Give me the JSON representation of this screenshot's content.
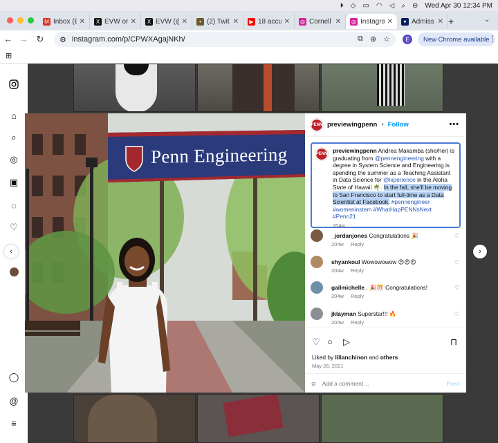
{
  "menubar": {
    "datetime": "Wed Apr 30  12:34 PM"
  },
  "tabs": [
    {
      "label": "Inbox (E",
      "icon": "gmail-icon",
      "color": "#d93025",
      "glyph": "M"
    },
    {
      "label": "EVW on",
      "icon": "x-icon",
      "color": "#111111",
      "glyph": "X"
    },
    {
      "label": "EVW (@",
      "icon": "x-icon",
      "color": "#111111",
      "glyph": "X"
    },
    {
      "label": "(2) Twit",
      "icon": "twitter-icon",
      "color": "#6b5a2a",
      "glyph": "•"
    },
    {
      "label": "18 accu",
      "icon": "youtube-icon",
      "color": "#ff0000",
      "glyph": "▶"
    },
    {
      "label": "Cornell",
      "icon": "instagram-icon",
      "color": "#d6249f",
      "glyph": "◎"
    },
    {
      "label": "Instagra",
      "icon": "instagram-icon",
      "color": "#d6249f",
      "glyph": "◎",
      "active": true
    },
    {
      "label": "Admiss",
      "icon": "penn-shield-icon",
      "color": "#011f5b",
      "glyph": "▾"
    }
  ],
  "browser": {
    "url": "instagram.com/p/CPWXAgajNKh/",
    "chrome_button": "New Chrome available",
    "profile_initial": "E"
  },
  "post": {
    "username": "previewingpenn",
    "follow": "Follow",
    "banner_text": "Penn Engineering",
    "caption": {
      "username": "previewingpenn",
      "part1": " Andrea Makamba (she/her) is graduating from ",
      "mention1": "@pennengineering",
      "part2": " with a degree in System Science and Engineering is spending the summer as a Teaching Assistant in Data Science for ",
      "mention2": "@ixperience",
      "part3": " in the Aloha State of Hawaii 🌴. ",
      "selected": "In the fall, she'll be moving to San Francisco to start full-time as a Data Scientist at Facebook.",
      "space": " ",
      "tags": "#pennengineer #womeninstem #WhatHapPENNsNext #Penn21",
      "time": "204w"
    },
    "comments": [
      {
        "user": "_jordanjones",
        "text": "Congratulations 🎉",
        "time": "204w",
        "reply": "Reply",
        "color": "#7a5a44"
      },
      {
        "user": "shyankoul",
        "text": "Wowowowow 😍😍😍",
        "time": "204w",
        "reply": "Reply",
        "color": "#b08a60"
      },
      {
        "user": "gailmichelle_",
        "text": "🎉🎊 Congratulations!",
        "time": "204w",
        "reply": "Reply",
        "color": "#6f8fa8"
      },
      {
        "user": "jklayman",
        "text": "Superstar!!! 🔥",
        "time": "204w",
        "reply": "Reply",
        "color": "#8b8f93"
      }
    ],
    "likes_prefix": "Liked by ",
    "likes_user": "lilianchinon",
    "likes_suffix": " and ",
    "likes_others": "others",
    "date": "May 26, 2021",
    "add_comment_placeholder": "Add a comment…",
    "post_button": "Post"
  },
  "colors": {
    "accent": "#0095f6",
    "selection_border": "#4a7bd6",
    "banner_bg": "#2b3a7a"
  }
}
